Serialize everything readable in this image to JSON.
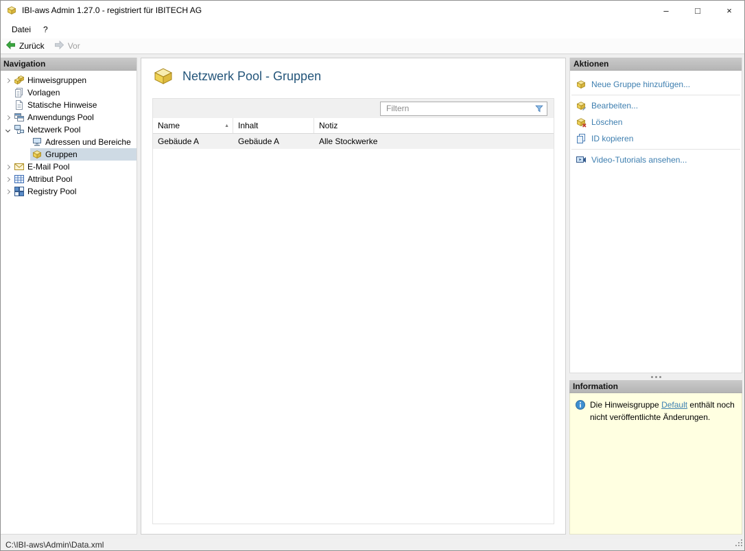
{
  "window": {
    "title": "IBI-aws Admin 1.27.0 - registriert für IBITECH AG",
    "controls": {
      "minimize": "–",
      "maximize": "□",
      "close": "×"
    }
  },
  "menu": {
    "items": [
      {
        "label": "Datei"
      },
      {
        "label": "?"
      }
    ]
  },
  "toolbar": {
    "back_label": "Zurück",
    "forward_label": "Vor"
  },
  "navigation": {
    "header": "Navigation",
    "items": [
      {
        "label": "Hinweisgruppen",
        "state": "collapsed"
      },
      {
        "label": "Vorlagen",
        "state": "leaf"
      },
      {
        "label": "Statische Hinweise",
        "state": "leaf"
      },
      {
        "label": "Anwendungs Pool",
        "state": "collapsed"
      },
      {
        "label": "Netzwerk Pool",
        "state": "expanded"
      },
      {
        "label": "Adressen und Bereiche",
        "state": "leaf",
        "child": true
      },
      {
        "label": "Gruppen",
        "state": "leaf",
        "child": true,
        "selected": true
      },
      {
        "label": "E-Mail Pool",
        "state": "collapsed"
      },
      {
        "label": "Attribut Pool",
        "state": "collapsed"
      },
      {
        "label": "Registry Pool",
        "state": "collapsed"
      }
    ]
  },
  "main": {
    "title": "Netzwerk Pool - Gruppen",
    "filter": {
      "placeholder": "Filtern"
    },
    "table": {
      "columns": [
        "Name",
        "Inhalt",
        "Notiz"
      ],
      "sort_indicator": "▲",
      "rows": [
        {
          "name": "Gebäude A",
          "inhalt": "Gebäude A",
          "notiz": "Alle Stockwerke"
        }
      ]
    }
  },
  "actions": {
    "header": "Aktionen",
    "items": [
      {
        "label": "Neue Gruppe hinzufügen..."
      },
      {
        "label": "Bearbeiten..."
      },
      {
        "label": "Löschen"
      },
      {
        "label": "ID kopieren"
      },
      {
        "label": "Video-Tutorials ansehen..."
      }
    ]
  },
  "information": {
    "header": "Information",
    "text_before": "Die Hinweisgruppe ",
    "link_label": "Default",
    "text_after": " enthält noch nicht veröffentlichte Änderungen."
  },
  "statusbar": {
    "path": "C:\\IBI-aws\\Admin\\Data.xml"
  },
  "colors": {
    "link": "#3D7EAF",
    "title_text": "#24557A",
    "info_background": "#FFFFE1",
    "selection": "#CEDAE4"
  }
}
